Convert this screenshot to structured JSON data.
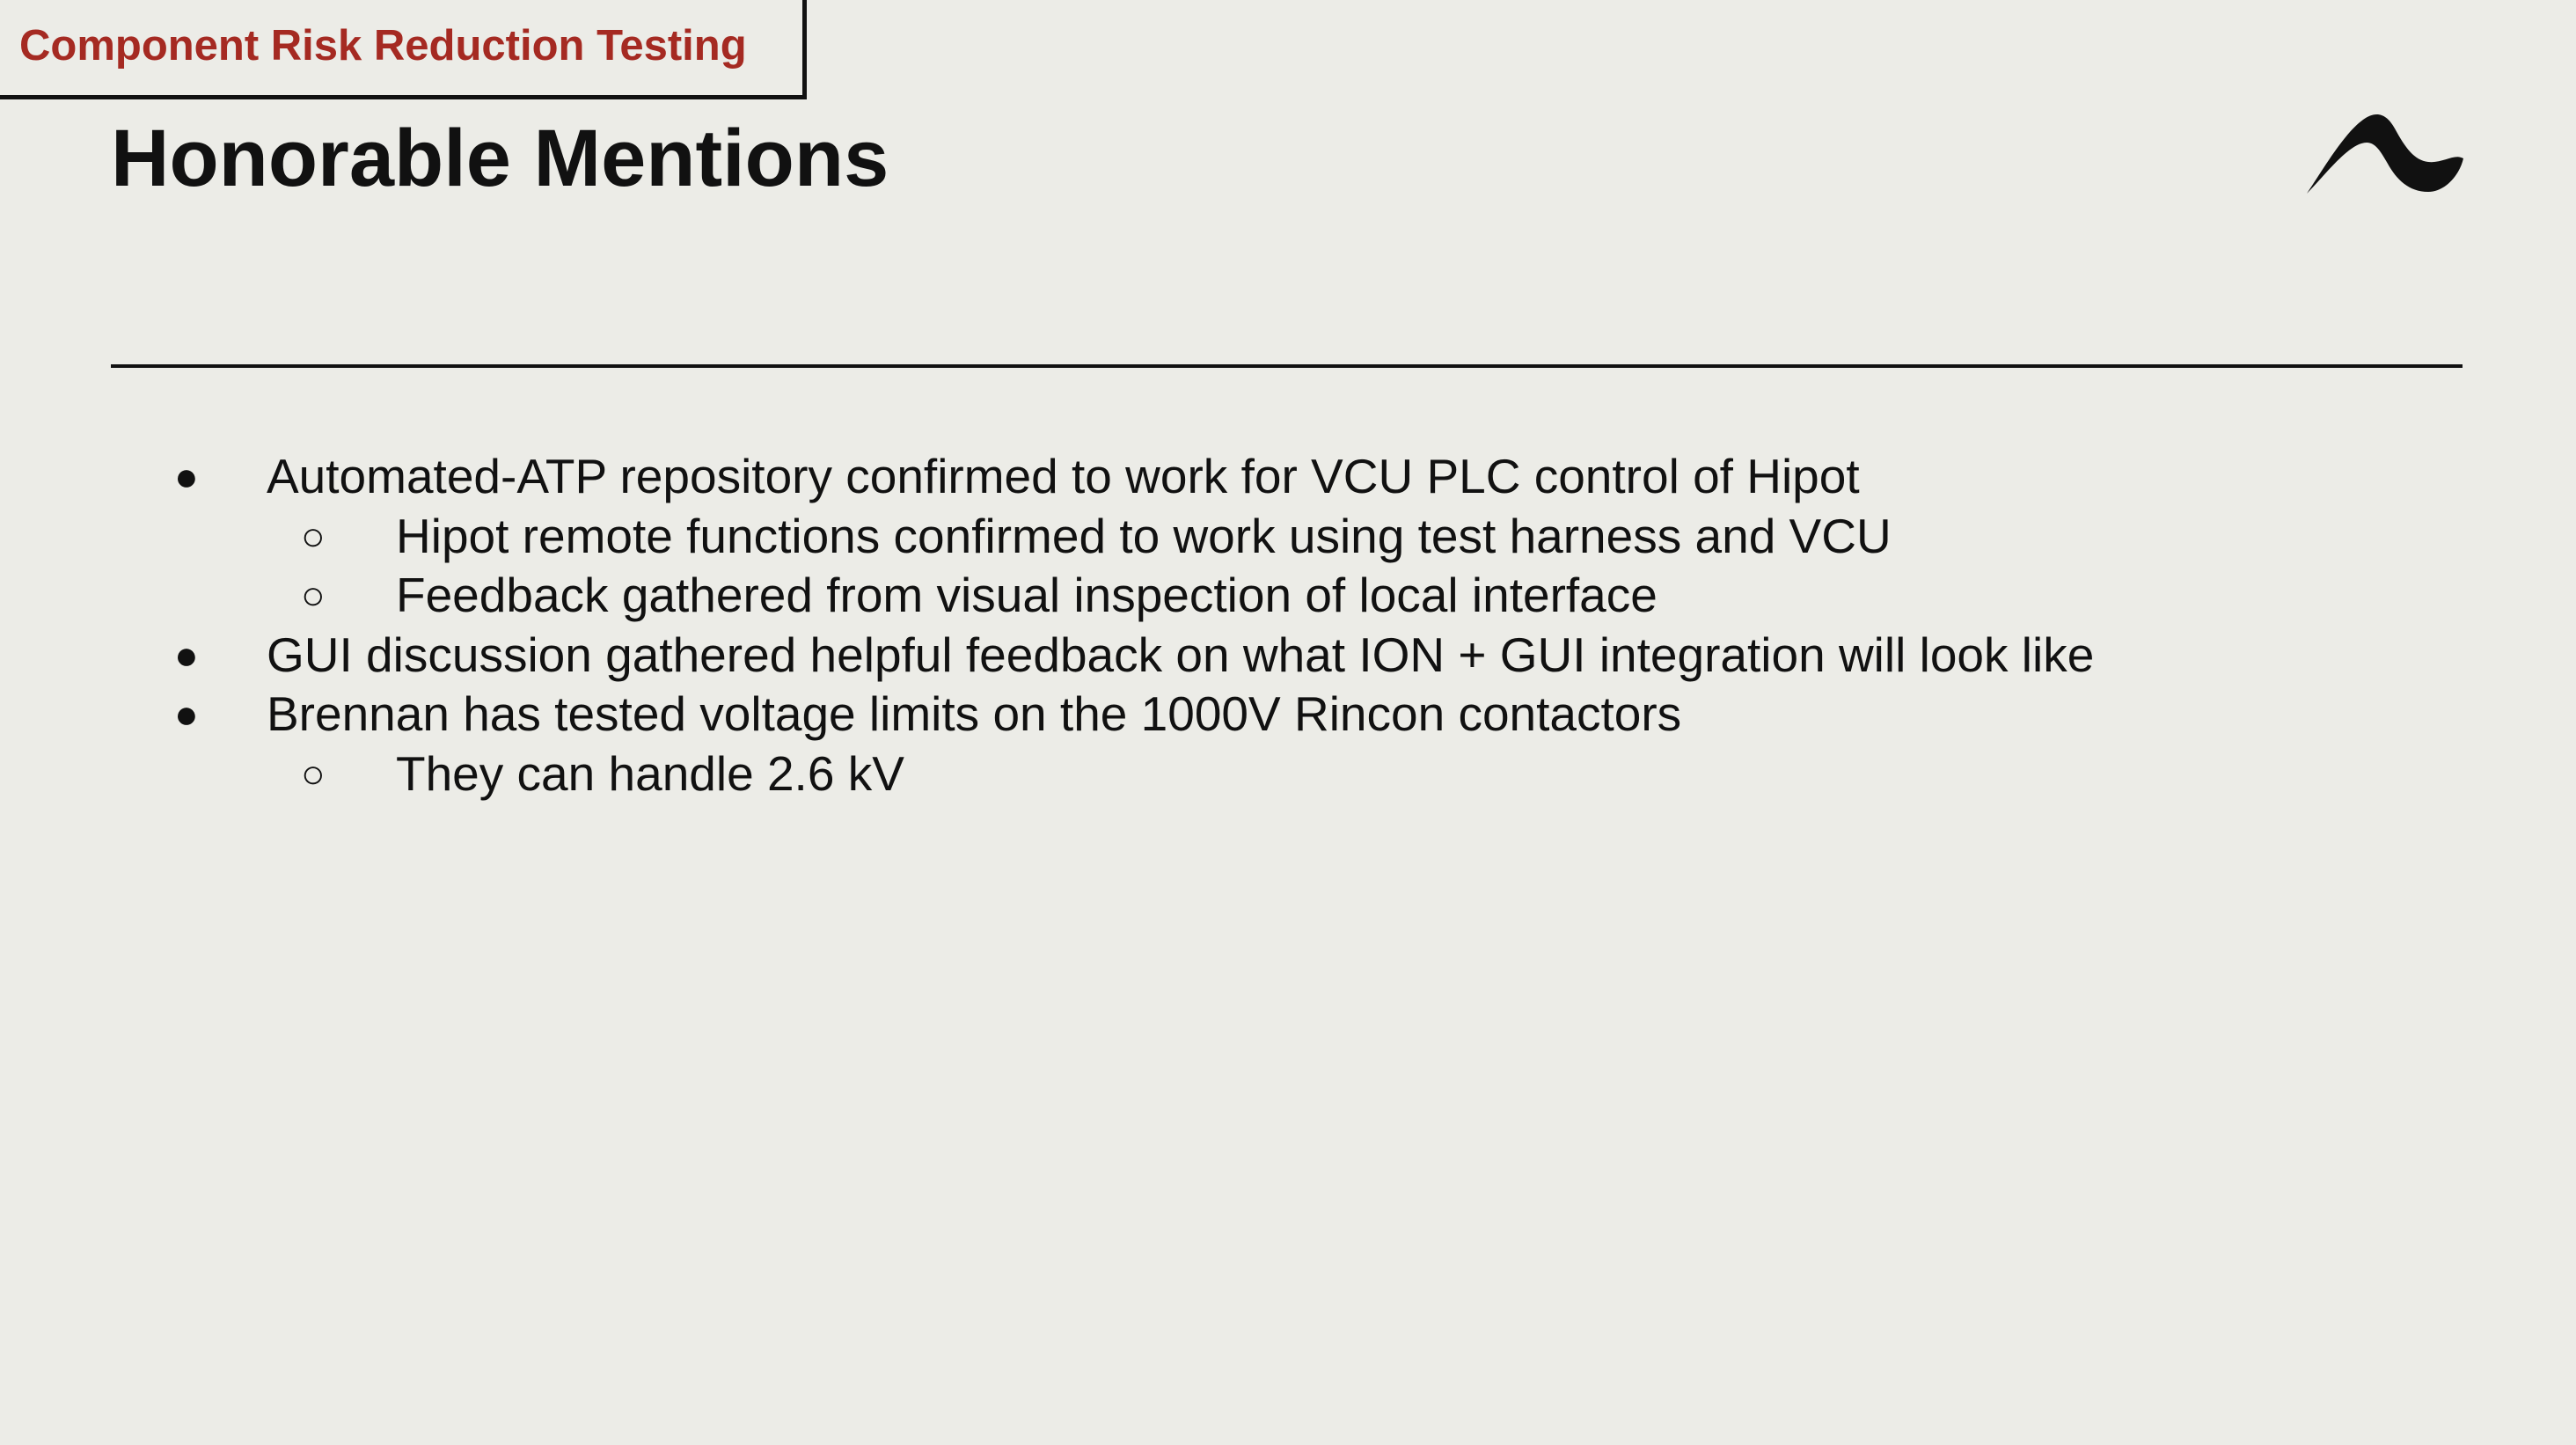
{
  "section_tag": "Component Risk Reduction Testing",
  "title": "Honorable Mentions",
  "logo_icon": "wave-arch-logo-icon",
  "accent_color": "#A52A22",
  "background_color": "#ECECE7",
  "bullets": [
    {
      "level": 1,
      "marker": "●",
      "text": "Automated-ATP repository confirmed to work for VCU PLC control of Hipot"
    },
    {
      "level": 2,
      "marker": "○",
      "text": "Hipot remote functions confirmed to work using test harness and VCU"
    },
    {
      "level": 2,
      "marker": "○",
      "text": "Feedback gathered from visual inspection of local interface"
    },
    {
      "level": 1,
      "marker": "●",
      "text": "GUI discussion gathered helpful feedback on what ION + GUI integration will look like"
    },
    {
      "level": 1,
      "marker": "●",
      "text": "Brennan has tested voltage limits on the 1000V Rincon contactors"
    },
    {
      "level": 2,
      "marker": "○",
      "text": "They can handle 2.6 kV"
    }
  ]
}
